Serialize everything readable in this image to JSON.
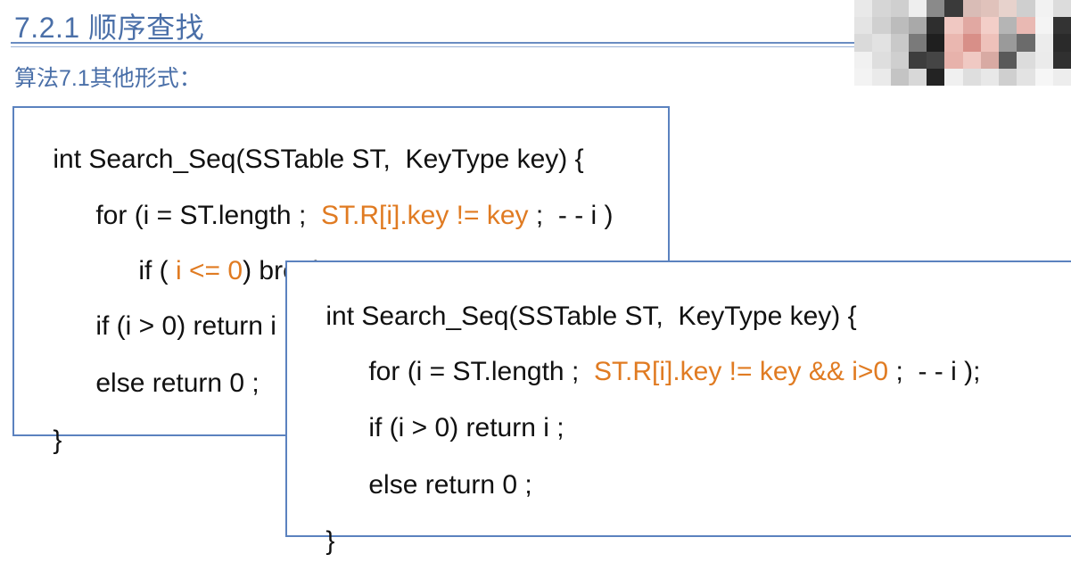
{
  "slide": {
    "title": "7.2.1 顺序查找",
    "subtitle": "算法7.1其他形式："
  },
  "code_box_1": {
    "lines": [
      {
        "pre": "int Search_Seq(SSTable ST,  KeyType key) {",
        "hl": "",
        "post": ""
      },
      {
        "pre": "for (i = ST.length ;  ",
        "hl": "ST.R[i].key != key",
        "post": " ;  - - i )"
      },
      {
        "pre": "if ( ",
        "hl": "i <= 0",
        "post": ") break ;"
      },
      {
        "pre": "if (i > 0) return i ;",
        "hl": "",
        "post": ""
      },
      {
        "pre": "else return 0 ;",
        "hl": "",
        "post": ""
      },
      {
        "pre": "}",
        "hl": "",
        "post": ""
      }
    ]
  },
  "code_box_2": {
    "lines": [
      {
        "pre": "int Search_Seq(SSTable ST,  KeyType key) {",
        "hl": "",
        "post": ""
      },
      {
        "pre": "for (i = ST.length ;  ",
        "hl": "ST.R[i].key != key && i>0",
        "post": " ;  - - i );"
      },
      {
        "pre": "if (i > 0) return i ;",
        "hl": "",
        "post": ""
      },
      {
        "pre": "else return 0 ;",
        "hl": "",
        "post": ""
      },
      {
        "pre": "}",
        "hl": "",
        "post": ""
      }
    ]
  },
  "colors": {
    "title": "#4a6fa8",
    "border": "#5b82bf",
    "highlight": "#e07b22",
    "code": "#111111"
  },
  "webcam": {
    "icon": "webcam-thumbnail",
    "pixels": [
      "#e9e9e9",
      "#d6d6d6",
      "#cfcfcf",
      "#eeeeee",
      "#8a8a8a",
      "#3a3a3a",
      "#d9bcb6",
      "#e0c2bb",
      "#e7d2cc",
      "#cfcfcf",
      "#f2f2f2",
      "#dcdcdc",
      "#e4e4e4",
      "#d0d0d0",
      "#bcbcbc",
      "#a9a9a9",
      "#2e2e2e",
      "#f0c8c2",
      "#e1a8a2",
      "#f3cec8",
      "#b5b5b5",
      "#e9b9b3",
      "#f4f4f4",
      "#333333",
      "#dadada",
      "#e2e2e2",
      "#c9c9c9",
      "#7a7a7a",
      "#1f1f1f",
      "#eab7b0",
      "#d88f88",
      "#eec1ba",
      "#9a9a9a",
      "#6b6b6b",
      "#ececec",
      "#2a2a2a",
      "#f1f1f1",
      "#dedede",
      "#cfcfcf",
      "#3d3d3d",
      "#454545",
      "#e7b2ab",
      "#f0c9c3",
      "#d8aaa3",
      "#595959",
      "#dcdcdc",
      "#ebebeb",
      "#303030",
      "#f3f3f3",
      "#eaeaea",
      "#c4c4c4",
      "#d8d8d8",
      "#232323",
      "#f0f0f0",
      "#dedede",
      "#e8e8e8",
      "#cfcfcf",
      "#e3e3e3",
      "#f6f6f6",
      "#ededed"
    ]
  }
}
